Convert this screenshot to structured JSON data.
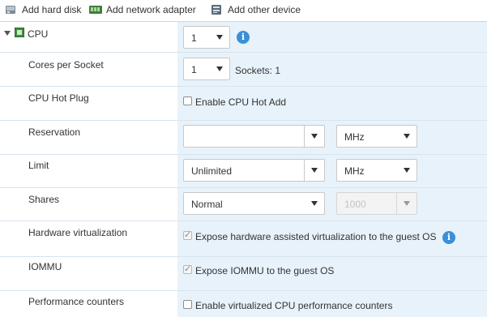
{
  "toolbar": {
    "add_hard_disk": "Add hard disk",
    "add_network_adapter": "Add network adapter",
    "add_other_device": "Add other device"
  },
  "cpu": {
    "section_label": "CPU",
    "value": "1",
    "expanded": true
  },
  "cores_per_socket": {
    "label": "Cores per Socket",
    "value": "1",
    "sockets_text": "Sockets: 1"
  },
  "cpu_hot_plug": {
    "label": "CPU Hot Plug",
    "checkbox_label": "Enable CPU Hot Add",
    "checked": false
  },
  "reservation": {
    "label": "Reservation",
    "value": "",
    "unit": "MHz"
  },
  "limit": {
    "label": "Limit",
    "value": "Unlimited",
    "unit": "MHz"
  },
  "shares": {
    "label": "Shares",
    "value": "Normal",
    "amount": "1000"
  },
  "hardware_virtualization": {
    "label": "Hardware virtualization",
    "checkbox_label": "Expose hardware assisted virtualization to the guest OS",
    "checked": true
  },
  "iommu": {
    "label": "IOMMU",
    "checkbox_label": "Expose IOMMU to the guest OS",
    "checked": true
  },
  "performance_counters": {
    "label": "Performance counters",
    "checkbox_label": "Enable virtualized CPU performance counters",
    "checked": false
  },
  "icons": {
    "hard_disk": "hard-disk-icon",
    "network_adapter": "network-adapter-icon",
    "other_device": "other-device-icon",
    "cpu": "cpu-chip-icon",
    "info": "info-icon"
  },
  "colors": {
    "panel_bg": "#e8f2fa",
    "info_blue": "#3b8fd8",
    "chip_green": "#3f8f3a"
  }
}
